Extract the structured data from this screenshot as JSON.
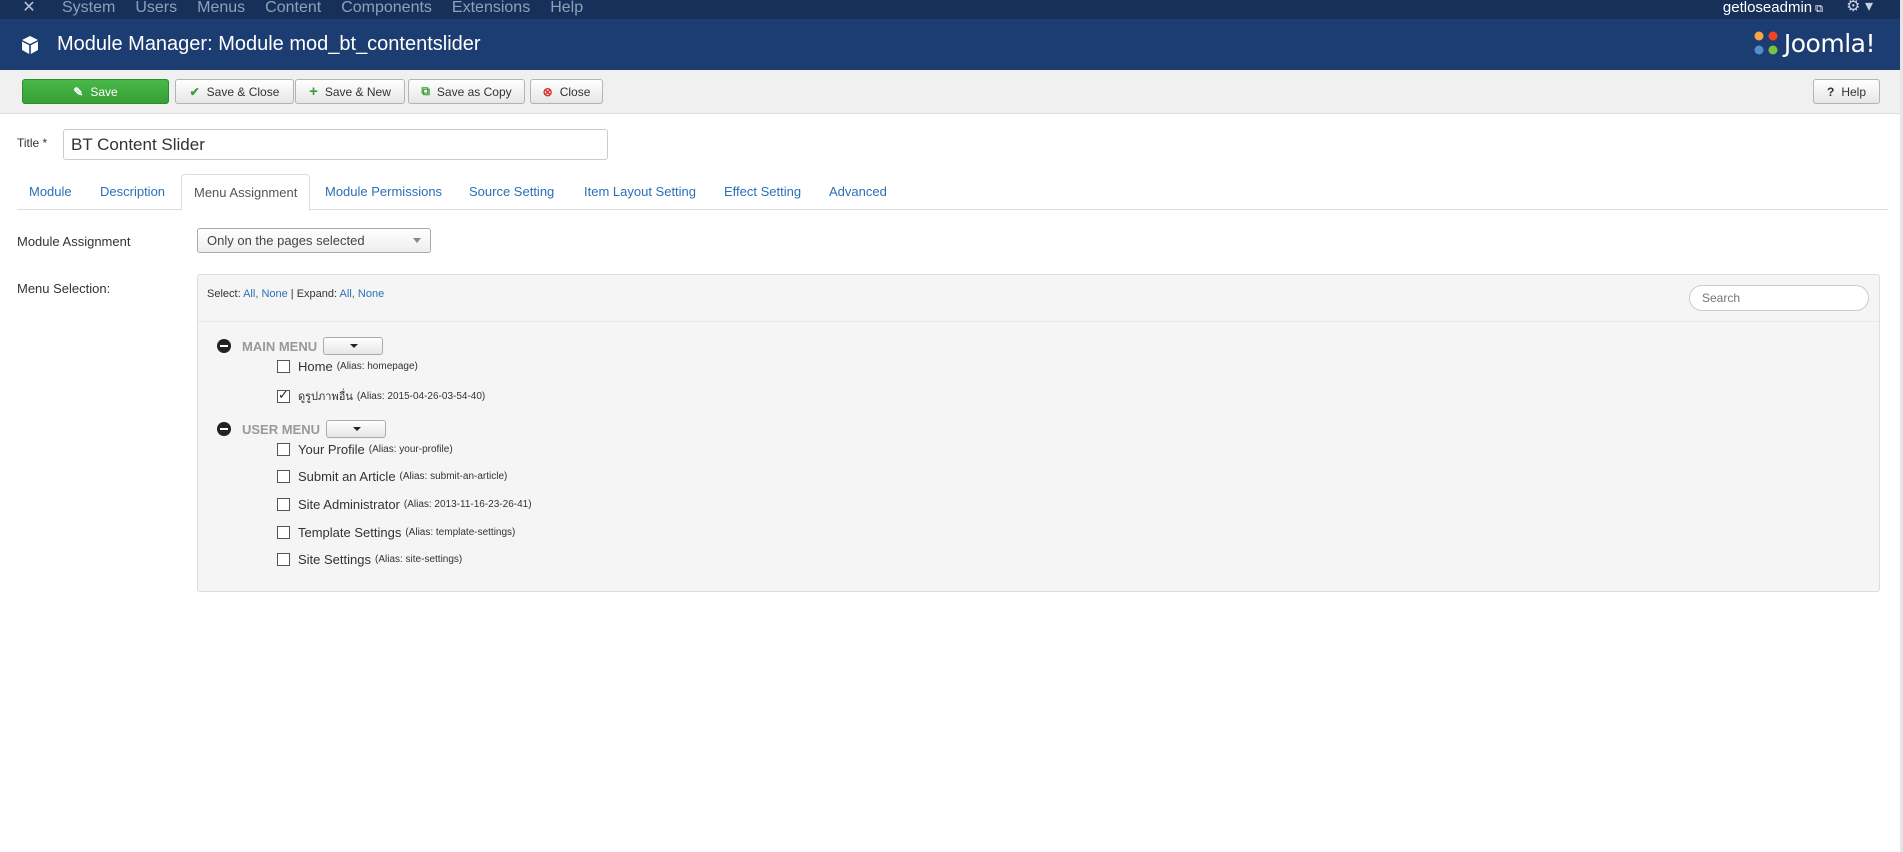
{
  "topnav": {
    "logo_icon": "joomla-icon",
    "items": [
      "System",
      "Users",
      "Menus",
      "Content",
      "Components",
      "Extensions",
      "Help"
    ],
    "user": "getloseadmin",
    "user_icon": "external-link-icon",
    "settings_icon": "gear-icon"
  },
  "header": {
    "title": "Module Manager: Module mod_bt_contentslider",
    "icon": "cube-icon",
    "brand": "Joomla!"
  },
  "toolbar": {
    "save": "Save",
    "save_close": "Save & Close",
    "save_new": "Save & New",
    "save_copy": "Save as Copy",
    "close": "Close",
    "help": "Help"
  },
  "form": {
    "title_label": "Title *",
    "title_value": "BT Content Slider"
  },
  "tabs": [
    "Module",
    "Description",
    "Menu Assignment",
    "Module Permissions",
    "Source Setting",
    "Item Layout Setting",
    "Effect Setting",
    "Advanced"
  ],
  "active_tab": "Menu Assignment",
  "assignment": {
    "label": "Module Assignment",
    "value": "Only on the pages selected"
  },
  "menu_selection": {
    "label": "Menu Selection:",
    "select_label": "Select:",
    "expand_label": "Expand:",
    "all": "All,",
    "none": "None",
    "separator": "|",
    "search_placeholder": "Search",
    "menus": [
      {
        "name": "MAIN MENU",
        "items": [
          {
            "label": "Home",
            "alias": "(Alias: homepage)",
            "checked": false
          },
          {
            "label": "ดูรูปภาพอื่น",
            "alias": "(Alias: 2015-04-26-03-54-40)",
            "checked": true
          }
        ]
      },
      {
        "name": "USER MENU",
        "items": [
          {
            "label": "Your Profile",
            "alias": "(Alias: your-profile)",
            "checked": false
          },
          {
            "label": "Submit an Article",
            "alias": "(Alias: submit-an-article)",
            "checked": false
          },
          {
            "label": "Site Administrator",
            "alias": "(Alias: 2013-11-16-23-26-41)",
            "checked": false
          },
          {
            "label": "Template Settings",
            "alias": "(Alias: template-settings)",
            "checked": false
          },
          {
            "label": "Site Settings",
            "alias": "(Alias: site-settings)",
            "checked": false
          }
        ]
      }
    ]
  },
  "colors": {
    "topbar": "#17305a",
    "header": "#1c3d71",
    "save_button": "#3ca93c",
    "link": "#2a70b8"
  }
}
